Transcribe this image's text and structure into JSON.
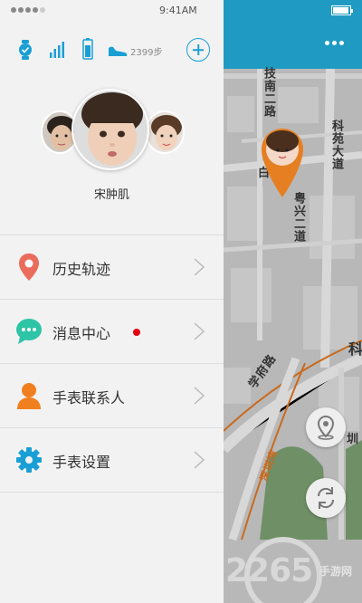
{
  "status_bar": {
    "time": "9:41AM"
  },
  "toolbar": {
    "steps_text": "2399步",
    "icons": [
      "watch-icon",
      "signal-icon",
      "battery-icon",
      "shoe-icon",
      "add-icon"
    ]
  },
  "child": {
    "name": "宋肿肌"
  },
  "menu": {
    "items": [
      {
        "label": "历史轨迹",
        "icon": "location-pin-icon"
      },
      {
        "label": "消息中心",
        "icon": "chat-bubble-icon",
        "badge": true
      },
      {
        "label": "手表联系人",
        "icon": "contact-person-icon"
      },
      {
        "label": "手表设置",
        "icon": "settings-gear-icon"
      }
    ]
  },
  "map": {
    "labels": [
      "技南二路",
      "科苑大道",
      "粤兴二道",
      "科",
      "学府路",
      "圳",
      "白",
      "深圳湾"
    ],
    "watermark": {
      "main": "2265",
      "sub": "手游网"
    },
    "buttons": [
      "locate-icon",
      "refresh-icon"
    ]
  },
  "colors": {
    "accent": "#1a9fd5",
    "header": "#1f9bc3",
    "pin": "#e67e22",
    "chat": "#2ec4a6",
    "contact": "#f0801f",
    "settings": "#1a9fd5",
    "history": "#ea6c5b",
    "badge": "#e60012"
  }
}
